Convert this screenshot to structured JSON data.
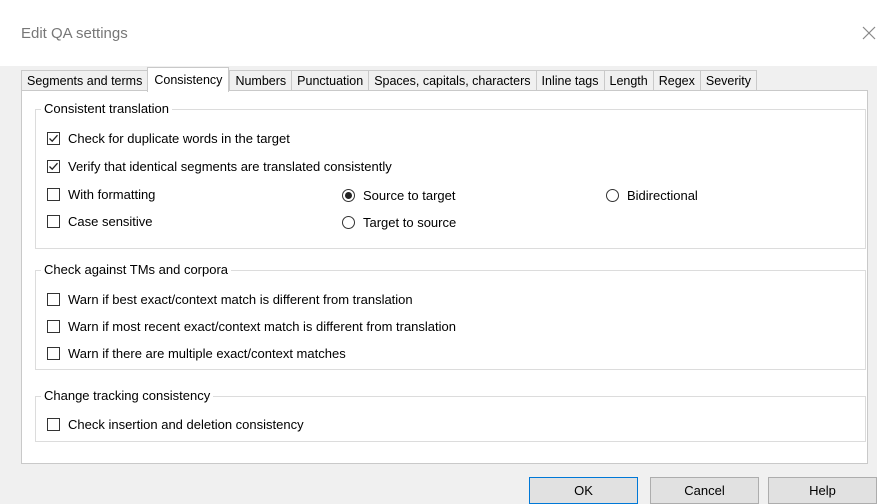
{
  "window": {
    "title": "Edit QA settings",
    "close_icon": "close-icon"
  },
  "tabs": [
    {
      "label": "Segments and terms",
      "active": false
    },
    {
      "label": "Consistency",
      "active": true
    },
    {
      "label": "Numbers",
      "active": false
    },
    {
      "label": "Punctuation",
      "active": false
    },
    {
      "label": "Spaces, capitals, characters",
      "active": false
    },
    {
      "label": "Inline tags",
      "active": false
    },
    {
      "label": "Length",
      "active": false
    },
    {
      "label": "Regex",
      "active": false
    },
    {
      "label": "Severity",
      "active": false
    }
  ],
  "consistent_translation": {
    "legend": "Consistent translation",
    "duplicate_words": {
      "label": "Check for duplicate words in the target",
      "checked": true
    },
    "identical_segments": {
      "label": "Verify that identical segments are translated consistently",
      "checked": true
    },
    "with_formatting": {
      "label": "With formatting",
      "checked": false
    },
    "case_sensitive": {
      "label": "Case sensitive",
      "checked": false
    },
    "source_to_target": {
      "label": "Source to target",
      "selected": true
    },
    "target_to_source": {
      "label": "Target to source",
      "selected": false
    },
    "bidirectional": {
      "label": "Bidirectional",
      "selected": false
    }
  },
  "tm_corpora": {
    "legend": "Check against TMs and corpora",
    "best_match": {
      "label": "Warn if best exact/context match is different from translation",
      "checked": false
    },
    "recent_match": {
      "label": "Warn if most recent exact/context match is different from translation",
      "checked": false
    },
    "multiple_matches": {
      "label": "Warn if there are multiple exact/context matches",
      "checked": false
    }
  },
  "change_tracking": {
    "legend": "Change tracking consistency",
    "insertion_deletion": {
      "label": "Check insertion and deletion consistency",
      "checked": false
    }
  },
  "buttons": {
    "ok": "OK",
    "cancel": "Cancel",
    "help": "Help"
  },
  "colors": {
    "dialog_background": "#f0f0f0",
    "panel_background": "#ffffff",
    "default_button_border": "#0078d7"
  }
}
